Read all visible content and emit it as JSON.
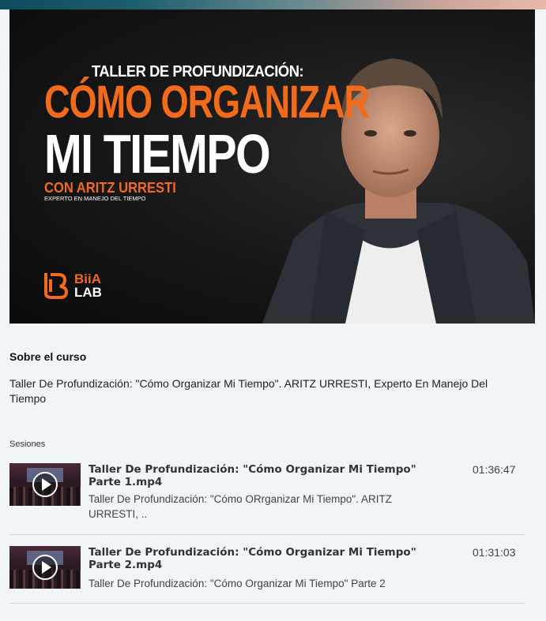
{
  "banner": {
    "subtitle": "TALLER DE PROFUNDIZACIÓN:",
    "headline_line1": "CÓMO ORGANIZAR",
    "headline_line2": "MI TIEMPO",
    "presenter": "CON ARITZ URRESTI",
    "presenter_role": "EXPERTO EN MANEJO DEL TIEMPO",
    "logo_top": "BiiA",
    "logo_bottom": "LAB",
    "accent_color": "#f26a1b"
  },
  "about": {
    "heading": "Sobre el curso",
    "description": "Taller De Profundización: \"Cómo Organizar Mi Tiempo\". ARITZ URRESTI, Experto En Manejo Del Tiempo"
  },
  "sessions": {
    "label": "Sesiones",
    "items": [
      {
        "title": "Taller De Profundización: \"Cómo Organizar Mi Tiempo\" Parte 1.mp4",
        "description": "Taller De Profundización: \"Cómo ORrganizar Mi Tiempo\". ARITZ URRESTI, ..",
        "duration": "01:36:47",
        "icon": "play-icon"
      },
      {
        "title": "Taller De Profundización: \"Cómo Organizar Mi Tiempo\" Parte 2.mp4",
        "description": "Taller De Profundización: \"Cómo Organizar Mi Tiempo\" Parte 2",
        "duration": "01:31:03",
        "icon": "play-icon"
      }
    ]
  }
}
